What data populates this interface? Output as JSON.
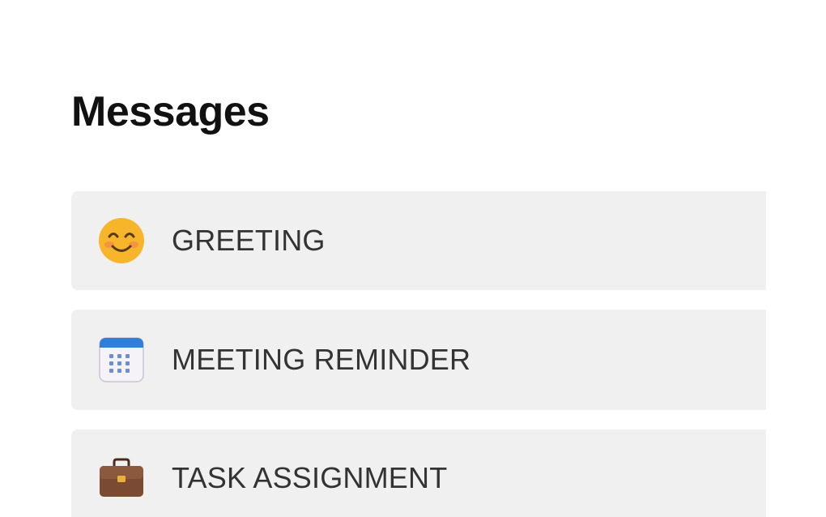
{
  "page": {
    "title": "Messages"
  },
  "messages": [
    {
      "label": "GREETING",
      "icon": "smiling-face-icon"
    },
    {
      "label": "MEETING REMINDER",
      "icon": "calendar-icon"
    },
    {
      "label": "TASK ASSIGNMENT",
      "icon": "briefcase-icon"
    }
  ],
  "colors": {
    "item_background": "#f0f0f0",
    "title_text": "#111111",
    "label_text": "#333333",
    "calendar_accent": "#2f7fd8",
    "briefcase_brown": "#7a4a32"
  }
}
